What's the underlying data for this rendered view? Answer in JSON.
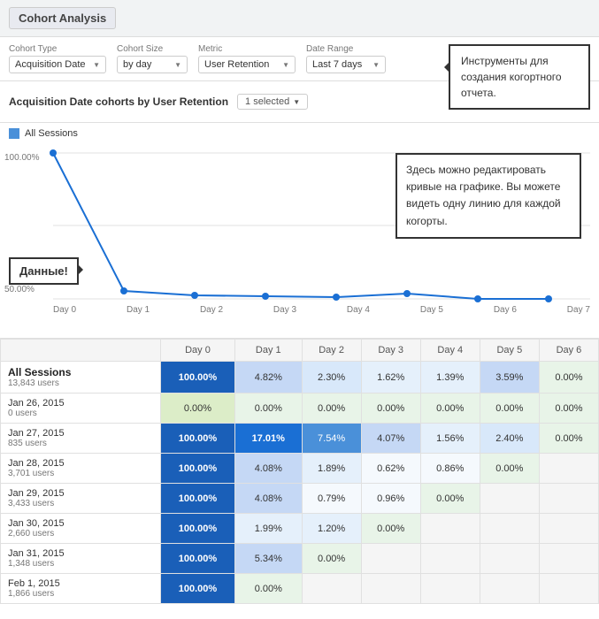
{
  "app": {
    "title": "Cohort Analysis"
  },
  "controls": {
    "cohort_type_label": "Cohort Type",
    "cohort_type_value": "Acquisition Date",
    "cohort_size_label": "Cohort Size",
    "cohort_size_value": "by day",
    "metric_label": "Metric",
    "metric_value": "User Retention",
    "date_range_label": "Date Range",
    "date_range_value": "Last 7 days"
  },
  "chart_header": {
    "title": "Acquisition Date cohorts by User Retention",
    "selected": "1 selected"
  },
  "legend": {
    "label": "All Sessions"
  },
  "tooltip_tools": {
    "text": "Инструменты для создания когортного отчета."
  },
  "tooltip_graph": {
    "text": "Здесь можно редактировать кривые на графике. Вы можете видеть одну линию для каждой когорты."
  },
  "tooltip_data": {
    "text": "Данные!"
  },
  "y_axis": {
    "labels": [
      "100.00%",
      "50.00%"
    ]
  },
  "x_axis": {
    "labels": [
      "Day 0",
      "Day 1",
      "Day 2",
      "Day 3",
      "Day 4",
      "Day 5",
      "Day 6",
      "Day 7"
    ]
  },
  "table": {
    "columns": [
      "",
      "Day 0",
      "Day 1",
      "Day 2",
      "Day 3",
      "Day 4",
      "Day 5",
      "Day 6"
    ],
    "rows": [
      {
        "label": "All Sessions",
        "sub": "13,843 users",
        "values": [
          "100.00%",
          "4.82%",
          "2.30%",
          "1.62%",
          "1.39%",
          "3.59%",
          "0.00%"
        ],
        "type": "all"
      },
      {
        "label": "Jan 26, 2015",
        "sub": "0 users",
        "values": [
          "0.00%",
          "0.00%",
          "0.00%",
          "0.00%",
          "0.00%",
          "0.00%",
          "0.00%"
        ],
        "type": "normal"
      },
      {
        "label": "Jan 27, 2015",
        "sub": "835 users",
        "values": [
          "100.00%",
          "17.01%",
          "7.54%",
          "4.07%",
          "1.56%",
          "2.40%",
          "0.00%"
        ],
        "type": "highlight"
      },
      {
        "label": "Jan 28, 2015",
        "sub": "3,701 users",
        "values": [
          "100.00%",
          "4.08%",
          "1.89%",
          "0.62%",
          "0.86%",
          "0.00%",
          ""
        ],
        "type": "normal"
      },
      {
        "label": "Jan 29, 2015",
        "sub": "3,433 users",
        "values": [
          "100.00%",
          "4.08%",
          "0.79%",
          "0.96%",
          "0.00%",
          "",
          ""
        ],
        "type": "normal"
      },
      {
        "label": "Jan 30, 2015",
        "sub": "2,660 users",
        "values": [
          "100.00%",
          "1.99%",
          "1.20%",
          "0.00%",
          "",
          "",
          ""
        ],
        "type": "normal"
      },
      {
        "label": "Jan 31, 2015",
        "sub": "1,348 users",
        "values": [
          "100.00%",
          "5.34%",
          "0.00%",
          "",
          "",
          "",
          ""
        ],
        "type": "normal"
      },
      {
        "label": "Feb 1, 2015",
        "sub": "1,866 users",
        "values": [
          "100.00%",
          "0.00%",
          "",
          "",
          "",
          "",
          ""
        ],
        "type": "normal"
      }
    ]
  }
}
